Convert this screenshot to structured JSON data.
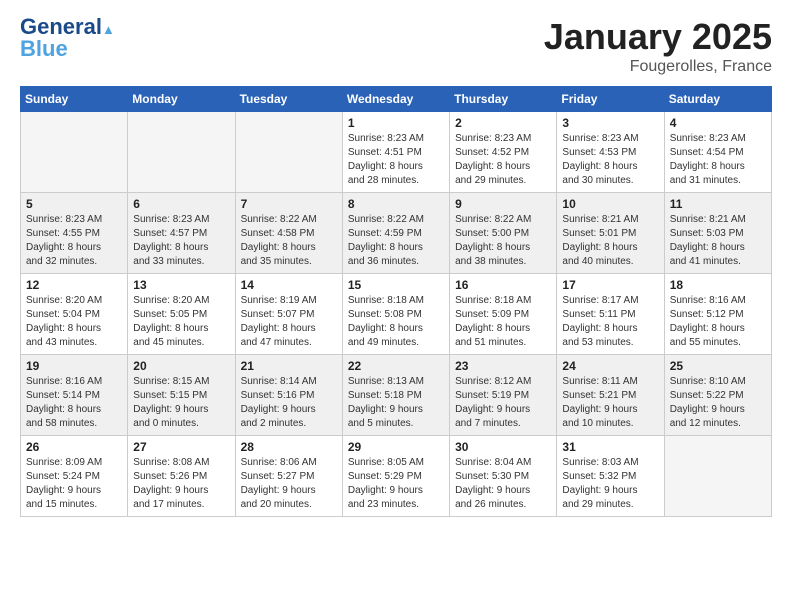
{
  "logo": {
    "line1": "General",
    "line2": "Blue"
  },
  "title": {
    "month": "January 2025",
    "location": "Fougerolles, France"
  },
  "days_of_week": [
    "Sunday",
    "Monday",
    "Tuesday",
    "Wednesday",
    "Thursday",
    "Friday",
    "Saturday"
  ],
  "weeks": [
    [
      {
        "day": "",
        "info": ""
      },
      {
        "day": "",
        "info": ""
      },
      {
        "day": "",
        "info": ""
      },
      {
        "day": "1",
        "info": "Sunrise: 8:23 AM\nSunset: 4:51 PM\nDaylight: 8 hours\nand 28 minutes."
      },
      {
        "day": "2",
        "info": "Sunrise: 8:23 AM\nSunset: 4:52 PM\nDaylight: 8 hours\nand 29 minutes."
      },
      {
        "day": "3",
        "info": "Sunrise: 8:23 AM\nSunset: 4:53 PM\nDaylight: 8 hours\nand 30 minutes."
      },
      {
        "day": "4",
        "info": "Sunrise: 8:23 AM\nSunset: 4:54 PM\nDaylight: 8 hours\nand 31 minutes."
      }
    ],
    [
      {
        "day": "5",
        "info": "Sunrise: 8:23 AM\nSunset: 4:55 PM\nDaylight: 8 hours\nand 32 minutes."
      },
      {
        "day": "6",
        "info": "Sunrise: 8:23 AM\nSunset: 4:57 PM\nDaylight: 8 hours\nand 33 minutes."
      },
      {
        "day": "7",
        "info": "Sunrise: 8:22 AM\nSunset: 4:58 PM\nDaylight: 8 hours\nand 35 minutes."
      },
      {
        "day": "8",
        "info": "Sunrise: 8:22 AM\nSunset: 4:59 PM\nDaylight: 8 hours\nand 36 minutes."
      },
      {
        "day": "9",
        "info": "Sunrise: 8:22 AM\nSunset: 5:00 PM\nDaylight: 8 hours\nand 38 minutes."
      },
      {
        "day": "10",
        "info": "Sunrise: 8:21 AM\nSunset: 5:01 PM\nDaylight: 8 hours\nand 40 minutes."
      },
      {
        "day": "11",
        "info": "Sunrise: 8:21 AM\nSunset: 5:03 PM\nDaylight: 8 hours\nand 41 minutes."
      }
    ],
    [
      {
        "day": "12",
        "info": "Sunrise: 8:20 AM\nSunset: 5:04 PM\nDaylight: 8 hours\nand 43 minutes."
      },
      {
        "day": "13",
        "info": "Sunrise: 8:20 AM\nSunset: 5:05 PM\nDaylight: 8 hours\nand 45 minutes."
      },
      {
        "day": "14",
        "info": "Sunrise: 8:19 AM\nSunset: 5:07 PM\nDaylight: 8 hours\nand 47 minutes."
      },
      {
        "day": "15",
        "info": "Sunrise: 8:18 AM\nSunset: 5:08 PM\nDaylight: 8 hours\nand 49 minutes."
      },
      {
        "day": "16",
        "info": "Sunrise: 8:18 AM\nSunset: 5:09 PM\nDaylight: 8 hours\nand 51 minutes."
      },
      {
        "day": "17",
        "info": "Sunrise: 8:17 AM\nSunset: 5:11 PM\nDaylight: 8 hours\nand 53 minutes."
      },
      {
        "day": "18",
        "info": "Sunrise: 8:16 AM\nSunset: 5:12 PM\nDaylight: 8 hours\nand 55 minutes."
      }
    ],
    [
      {
        "day": "19",
        "info": "Sunrise: 8:16 AM\nSunset: 5:14 PM\nDaylight: 8 hours\nand 58 minutes."
      },
      {
        "day": "20",
        "info": "Sunrise: 8:15 AM\nSunset: 5:15 PM\nDaylight: 9 hours\nand 0 minutes."
      },
      {
        "day": "21",
        "info": "Sunrise: 8:14 AM\nSunset: 5:16 PM\nDaylight: 9 hours\nand 2 minutes."
      },
      {
        "day": "22",
        "info": "Sunrise: 8:13 AM\nSunset: 5:18 PM\nDaylight: 9 hours\nand 5 minutes."
      },
      {
        "day": "23",
        "info": "Sunrise: 8:12 AM\nSunset: 5:19 PM\nDaylight: 9 hours\nand 7 minutes."
      },
      {
        "day": "24",
        "info": "Sunrise: 8:11 AM\nSunset: 5:21 PM\nDaylight: 9 hours\nand 10 minutes."
      },
      {
        "day": "25",
        "info": "Sunrise: 8:10 AM\nSunset: 5:22 PM\nDaylight: 9 hours\nand 12 minutes."
      }
    ],
    [
      {
        "day": "26",
        "info": "Sunrise: 8:09 AM\nSunset: 5:24 PM\nDaylight: 9 hours\nand 15 minutes."
      },
      {
        "day": "27",
        "info": "Sunrise: 8:08 AM\nSunset: 5:26 PM\nDaylight: 9 hours\nand 17 minutes."
      },
      {
        "day": "28",
        "info": "Sunrise: 8:06 AM\nSunset: 5:27 PM\nDaylight: 9 hours\nand 20 minutes."
      },
      {
        "day": "29",
        "info": "Sunrise: 8:05 AM\nSunset: 5:29 PM\nDaylight: 9 hours\nand 23 minutes."
      },
      {
        "day": "30",
        "info": "Sunrise: 8:04 AM\nSunset: 5:30 PM\nDaylight: 9 hours\nand 26 minutes."
      },
      {
        "day": "31",
        "info": "Sunrise: 8:03 AM\nSunset: 5:32 PM\nDaylight: 9 hours\nand 29 minutes."
      },
      {
        "day": "",
        "info": ""
      }
    ]
  ]
}
